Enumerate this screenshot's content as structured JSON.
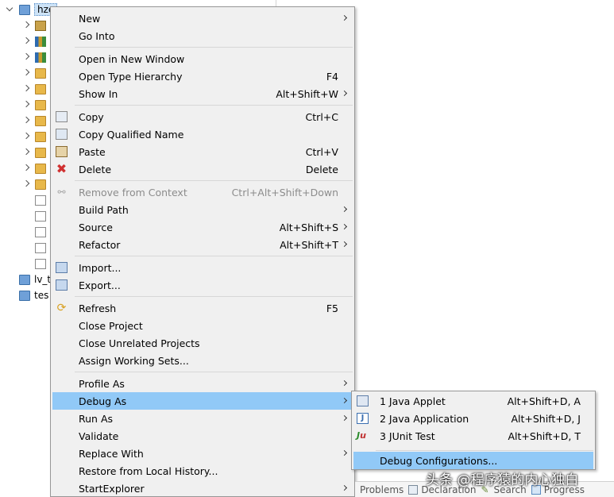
{
  "explorer": {
    "root_label": "hze",
    "folder_label_1": "lv_t",
    "folder_label_2": "tes"
  },
  "menu": {
    "items": [
      {
        "label": "New",
        "accel": "",
        "submenu": true
      },
      {
        "label": "Go Into",
        "accel": "",
        "submenu": false
      },
      {
        "label": "Open in New Window",
        "accel": "",
        "submenu": false
      },
      {
        "label": "Open Type Hierarchy",
        "accel": "F4",
        "submenu": false
      },
      {
        "label": "Show In",
        "accel": "Alt+Shift+W",
        "submenu": true
      },
      {
        "label": "Copy",
        "accel": "Ctrl+C",
        "submenu": false
      },
      {
        "label": "Copy Qualified Name",
        "accel": "",
        "submenu": false
      },
      {
        "label": "Paste",
        "accel": "Ctrl+V",
        "submenu": false
      },
      {
        "label": "Delete",
        "accel": "Delete",
        "submenu": false
      },
      {
        "label": "Remove from Context",
        "accel": "Ctrl+Alt+Shift+Down",
        "submenu": false
      },
      {
        "label": "Build Path",
        "accel": "",
        "submenu": true
      },
      {
        "label": "Source",
        "accel": "Alt+Shift+S",
        "submenu": true
      },
      {
        "label": "Refactor",
        "accel": "Alt+Shift+T",
        "submenu": true
      },
      {
        "label": "Import...",
        "accel": "",
        "submenu": false
      },
      {
        "label": "Export...",
        "accel": "",
        "submenu": false
      },
      {
        "label": "Refresh",
        "accel": "F5",
        "submenu": false
      },
      {
        "label": "Close Project",
        "accel": "",
        "submenu": false
      },
      {
        "label": "Close Unrelated Projects",
        "accel": "",
        "submenu": false
      },
      {
        "label": "Assign Working Sets...",
        "accel": "",
        "submenu": false
      },
      {
        "label": "Profile As",
        "accel": "",
        "submenu": true
      },
      {
        "label": "Debug As",
        "accel": "",
        "submenu": true
      },
      {
        "label": "Run As",
        "accel": "",
        "submenu": true
      },
      {
        "label": "Validate",
        "accel": "",
        "submenu": false
      },
      {
        "label": "Replace With",
        "accel": "",
        "submenu": true
      },
      {
        "label": "Restore from Local History...",
        "accel": "",
        "submenu": false
      },
      {
        "label": "StartExplorer",
        "accel": "",
        "submenu": true
      }
    ]
  },
  "submenu": {
    "items": [
      {
        "label": "1 Java Applet",
        "accel": "Alt+Shift+D, A"
      },
      {
        "label": "2 Java Application",
        "accel": "Alt+Shift+D, J"
      },
      {
        "label": "3 JUnit Test",
        "accel": "Alt+Shift+D, T"
      },
      {
        "label": "Debug Configurations...",
        "accel": ""
      }
    ]
  },
  "bottom_tabs": {
    "problems": "Problems",
    "declaration": "Declaration",
    "search": "Search",
    "progress": "Progress"
  },
  "watermark": "头条 @程序猿的内心独白",
  "colors": {
    "highlight": "#91c9f7",
    "menu_bg": "#f0f0f0",
    "disabled_text": "#8c8c8c"
  }
}
